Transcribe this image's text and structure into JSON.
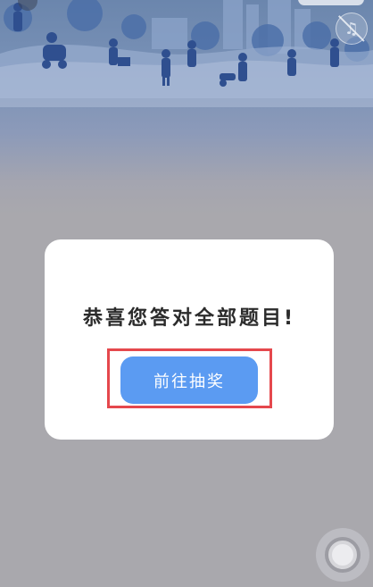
{
  "banner": {
    "music_icon": "music-note-muted-icon",
    "colors": {
      "sky_top": "#6b86ad",
      "silhouette": "#2f4f8f"
    }
  },
  "dialog": {
    "title": "恭喜您答对全部题目!",
    "button_label": "前往抽奖",
    "button_color": "#5b9bf2",
    "highlight_color": "#e5484d"
  },
  "floating_button": {
    "icon": "assistive-touch-icon"
  }
}
